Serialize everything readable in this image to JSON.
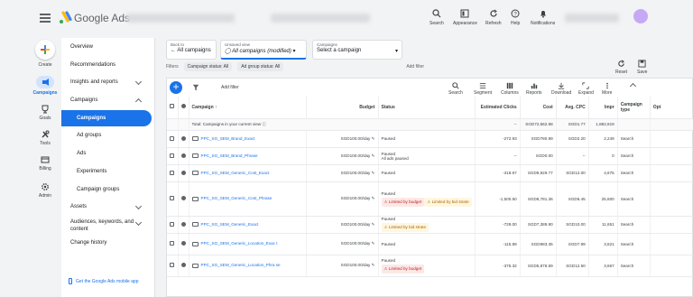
{
  "app": {
    "title": "Google Ads"
  },
  "toolbar": [
    {
      "label": "Search",
      "icon": "search-icon"
    },
    {
      "label": "Appearance",
      "icon": "appearance-icon"
    },
    {
      "label": "Refresh",
      "icon": "refresh-icon"
    },
    {
      "label": "Help",
      "icon": "help-icon"
    },
    {
      "label": "Notifications",
      "icon": "bell-icon"
    }
  ],
  "rail": {
    "create": "Create",
    "campaigns": "Campaigns",
    "goals": "Goals",
    "tools": "Tools",
    "billing": "Billing",
    "admin": "Admin"
  },
  "nav": {
    "overview": "Overview",
    "recommendations": "Recommendations",
    "insights": "Insights and reports",
    "campaigns_section": "Campaigns",
    "campaigns": "Campaigns",
    "ad_groups": "Ad groups",
    "ads": "Ads",
    "experiments": "Experiments",
    "campaign_groups": "Campaign groups",
    "assets": "Assets",
    "audiences": "Audiences, keywords, and content",
    "change_history": "Change history",
    "mobile_app": "Get the Google Ads mobile app"
  },
  "selectors": {
    "back_label": "Back to",
    "back_value": "All campaigns",
    "view_label": "Unsaved view",
    "view_value": "All campaigns (modified)",
    "campaigns_label": "Campaigns",
    "campaigns_value": "Select a campaign"
  },
  "filters": {
    "label": "Filters",
    "chips": [
      "Campaign status: All",
      "Ad group status: All"
    ],
    "add": "Add filter"
  },
  "reset": "Reset",
  "save": "Save",
  "table_toolbar": {
    "add_filter": "Add filter",
    "tools": [
      "Search",
      "Segment",
      "Columns",
      "Reports",
      "Download",
      "Expand",
      "More"
    ]
  },
  "columns": [
    "Campaign",
    "Budget",
    "Status",
    "Estimated Clicks",
    "Cost",
    "Avg. CPC",
    "Impr",
    "Campaign type",
    "Opt"
  ],
  "total_row": {
    "label": "Total: Campaigns in your current view",
    "clicks": "--",
    "cost": "SGD72,562.58",
    "cpc": "SGD1.77",
    "impr": "1,882,919"
  },
  "rows": [
    {
      "name": "PPC_SG_SEM_Brand_Exact",
      "budget": "SGD100.00/day",
      "status": "Paused",
      "status2": "",
      "badge": "",
      "badge2": "",
      "clicks": "-272.93",
      "cost": "SGD780.99",
      "cpc": "SGD2.20",
      "impr": "2,249",
      "type": "Search"
    },
    {
      "name": "PPC_SG_SEM_Brand_Phrase",
      "budget": "SGD100.00/day",
      "status": "Paused",
      "status2": "All ads paused",
      "badge": "",
      "badge2": "",
      "clicks": "--",
      "cost": "SGD0.00",
      "cpc": "--",
      "impr": "0",
      "type": "Search"
    },
    {
      "name": "PPC_SG_SEM_Generic_Cost_Exact",
      "budget": "SGD100.00/day",
      "status": "Paused",
      "status2": "",
      "badge": "",
      "badge2": "",
      "clicks": "-318.67",
      "cost": "SGD9,929.77",
      "cpc": "SGD12.00",
      "impr": "4,675",
      "type": "Search"
    },
    {
      "name": "PPC_SG_SEM_Generic_Cost_Phrase",
      "budget": "SGD100.00/day",
      "status": "Paused",
      "status2": "",
      "badge": "Limited by budget",
      "badge2": "Limited by bid strate",
      "clicks": "-1,500.50",
      "cost": "SGD8,781.36",
      "cpc": "SGD6.45",
      "impr": "25,600",
      "type": "Search"
    },
    {
      "name": "PPC_SG_SEM_Generic_Exact",
      "budget": "SGD100.00/day",
      "status": "Paused",
      "status2": "",
      "badge": "Limited by bid strate",
      "badge2": "",
      "clicks": "-729.00",
      "cost": "SGD7,389.90",
      "cpc": "SGD10.00",
      "impr": "11,651",
      "type": "Search"
    },
    {
      "name": "PPC_SG_SEM_Generic_Location_Exac t",
      "budget": "SGD100.00/day",
      "status": "Paused",
      "status2": "",
      "badge": "",
      "badge2": "",
      "clicks": "-115.89",
      "cost": "SGD983.35",
      "cpc": "SGD7.99",
      "impr": "3,621",
      "type": "Search"
    },
    {
      "name": "PPC_SG_SEM_Generic_Location_Phra se",
      "budget": "SGD100.00/day",
      "status": "Paused",
      "status2": "",
      "badge": "Limited by budget",
      "badge2": "",
      "clicks": "-375.32",
      "cost": "SGD5,876.59",
      "cpc": "SGD12.50",
      "impr": "3,667",
      "type": "Search"
    }
  ],
  "colors": {
    "accent": "#1a73e8",
    "limited_budget": "#c5221f",
    "limited_bid": "#b06000"
  }
}
